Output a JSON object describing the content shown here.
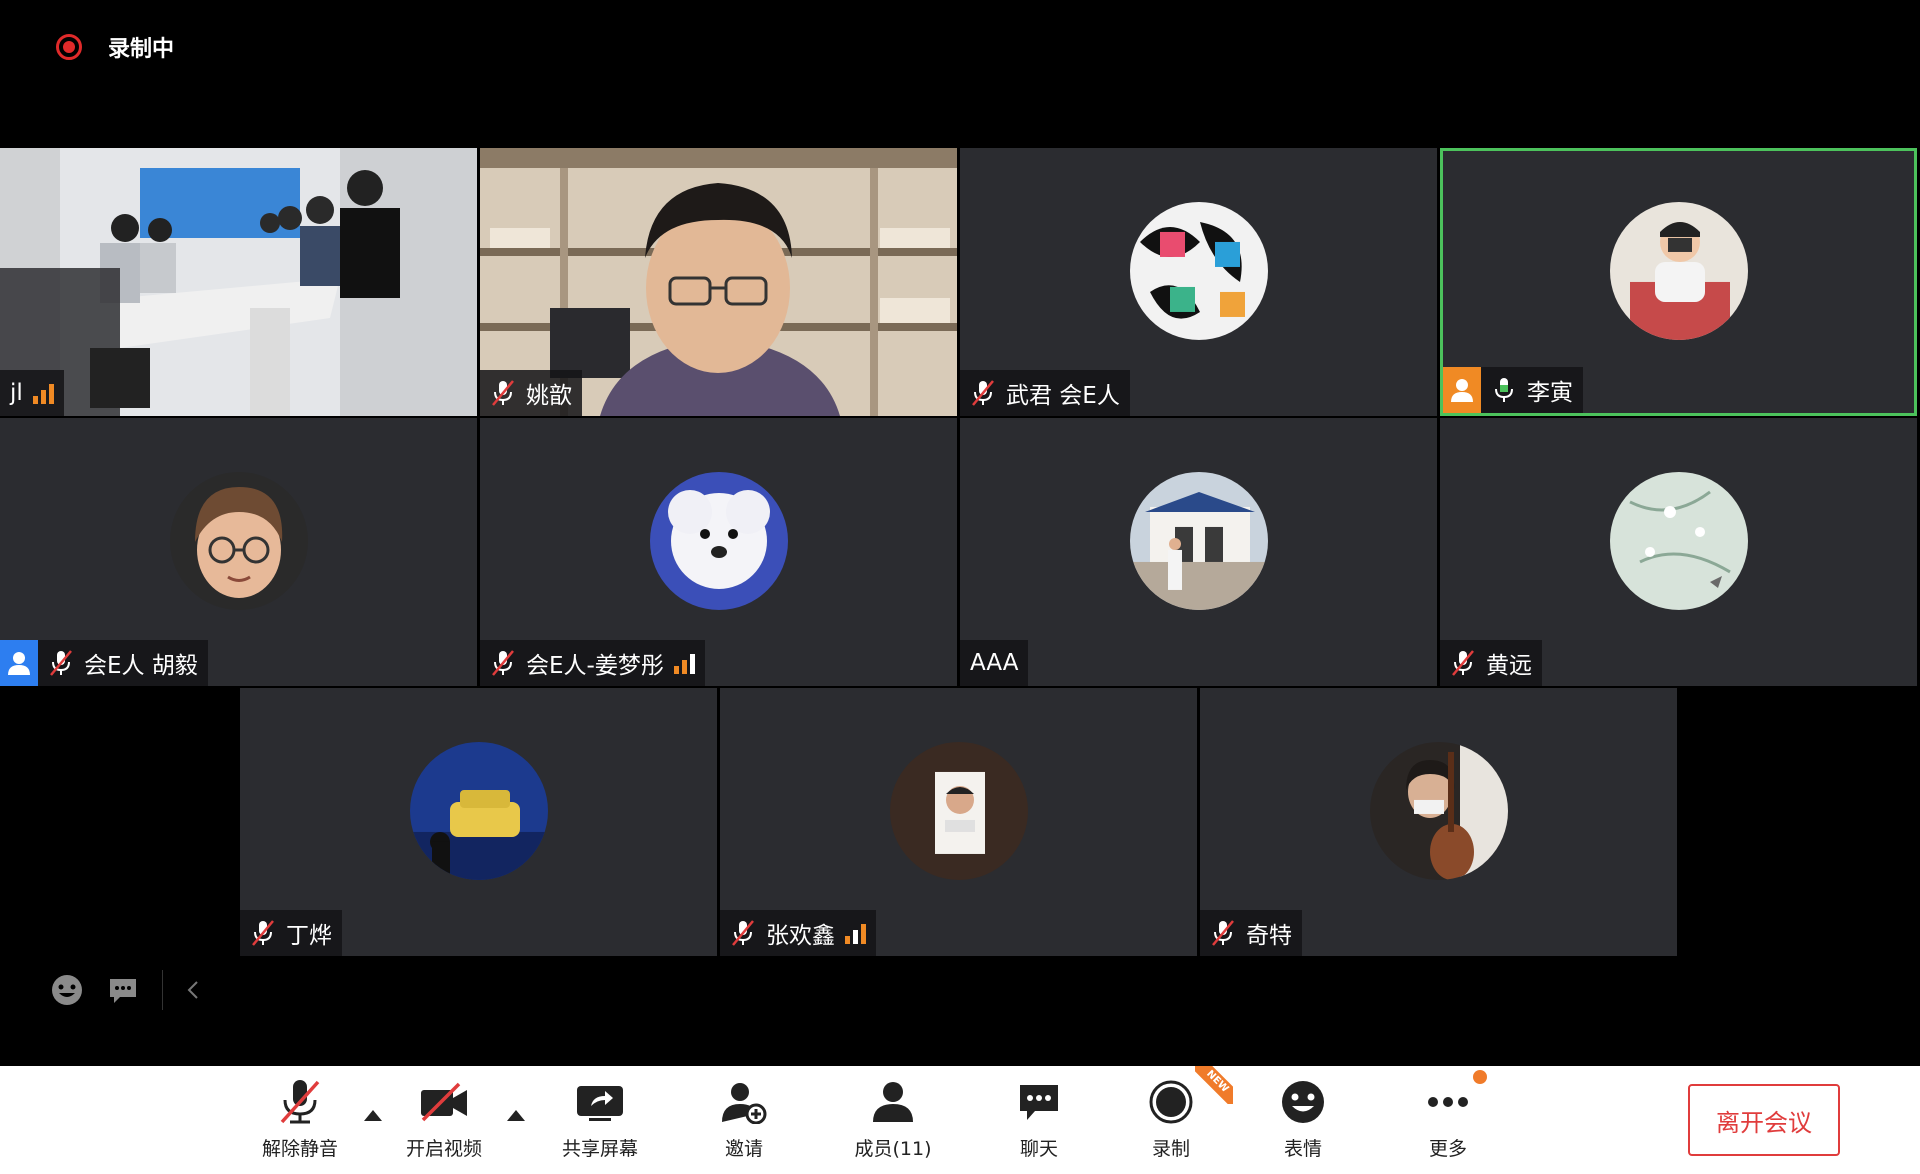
{
  "recording": {
    "label": "录制中",
    "color": "#e02a2a"
  },
  "participants": [
    {
      "name": "jl",
      "mic": "none",
      "signal": 3,
      "type": "video-room"
    },
    {
      "name": "姚歆",
      "mic": "muted",
      "signal": 0,
      "type": "video-person"
    },
    {
      "name": "武君 会E人",
      "mic": "muted",
      "signal": 0,
      "type": "avatar"
    },
    {
      "name": "李寅",
      "mic": "active",
      "signal": 0,
      "type": "avatar",
      "active_speaker": true,
      "badge": "user-icon-orange"
    },
    {
      "name": "会E人 胡毅",
      "mic": "muted",
      "signal": 0,
      "type": "avatar",
      "badge": "user-icon-blue"
    },
    {
      "name": "会E人-姜梦彤",
      "mic": "muted",
      "signal": 3,
      "type": "avatar"
    },
    {
      "name": "AAA",
      "mic": "none",
      "signal": 0,
      "type": "avatar"
    },
    {
      "name": "黄远",
      "mic": "muted",
      "signal": 0,
      "type": "avatar"
    },
    {
      "name": "丁烨",
      "mic": "muted",
      "signal": 0,
      "type": "avatar"
    },
    {
      "name": "张欢鑫",
      "mic": "muted",
      "signal": 3,
      "type": "avatar"
    },
    {
      "name": "奇特",
      "mic": "muted",
      "signal": 0,
      "type": "avatar"
    }
  ],
  "toolbar": {
    "unmute": "解除静音",
    "start_video": "开启视频",
    "share_screen": "共享屏幕",
    "invite": "邀请",
    "members": "成员(11)",
    "chat": "聊天",
    "record": "录制",
    "record_badge": "NEW",
    "reactions": "表情",
    "more": "更多",
    "leave": "离开会议"
  },
  "colors": {
    "active_border": "#4cc25c",
    "leave": "#e03c3c",
    "signal": "#f08a24"
  }
}
